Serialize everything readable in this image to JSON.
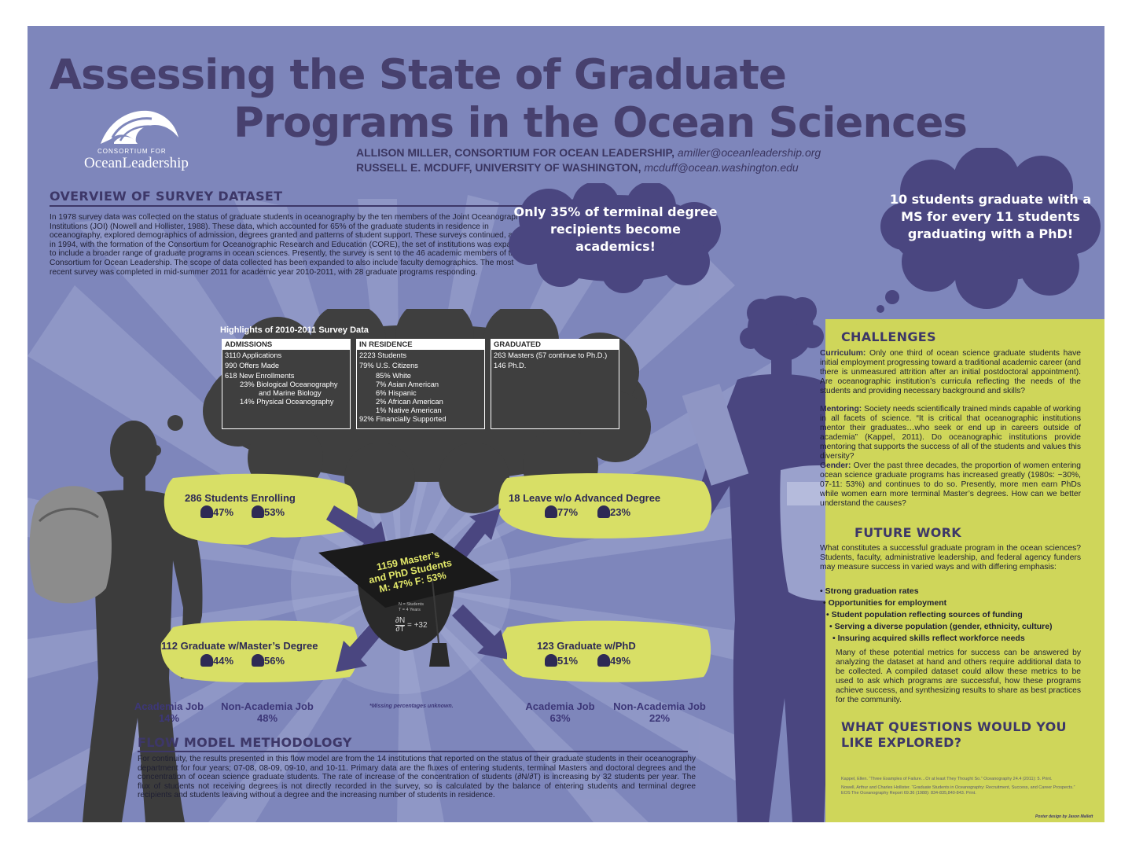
{
  "title": {
    "line1": "Assessing the State of Graduate",
    "line2": "Programs in the Ocean Sciences"
  },
  "logo": {
    "small": "CONSORTIUM FOR",
    "brand_part1": "Ocean",
    "brand_part2": "Leadership"
  },
  "authors": [
    {
      "name": "ALLISON MILLER, CONSORTIUM FOR OCEAN LEADERSHIP,",
      "email": "amiller@oceanleadership.org"
    },
    {
      "name": "RUSSELL E. MCDUFF, UNIVERSITY OF WASHINGTON,",
      "email": "mcduff@ocean.washington.edu"
    }
  ],
  "overview": {
    "heading": "OVERVIEW OF SURVEY DATASET",
    "body": "In 1978 survey data was collected on the status of graduate students in oceanography by the ten members of the Joint Oceanographic Institutions (JOI) (Nowell and Hollister, 1988). These data, which accounted for 65% of the graduate students in residence in oceanography, explored demographics of admission, degrees granted and patterns of student support. These surveys continued, and in 1994, with the formation of the Consortium for Oceanographic Research and Education (CORE), the set of institutions was expanded to include a broader range of graduate programs in ocean sciences. Presently, the survey is sent to the 46 academic members of the Consortium for Ocean Leadership. The scope of data collected has been expanded to also include faculty demographics. The most recent survey was completed in mid-summer 2011 for academic year 2010-2011, with 28 graduate programs responding."
  },
  "clouds": {
    "academics": "Only 35% of terminal degree recipients become academics!",
    "ms_phd": "10 students graduate with a MS for every 11 students graduating with a PhD!"
  },
  "highlights": {
    "title": "Highlights of 2010-2011 Survey Data",
    "admissions": {
      "heading": "ADMISSIONS",
      "lines": [
        "3110 Applications",
        "990 Offers Made",
        "618 New Enrollments",
        "23%  Biological Oceanography",
        "and Marine Biology",
        "14%  Physical Oceanography"
      ]
    },
    "residence": {
      "heading": "IN RESIDENCE",
      "lines": [
        "2223 Students",
        "79% U.S. Citizens",
        "85% White",
        "7% Asian American",
        "6% Hispanic",
        "2% African American",
        "1% Native American",
        "92% Financially Supported"
      ]
    },
    "graduated": {
      "heading": "GRADUATED",
      "lines": [
        "263 Masters (57 continue to Ph.D.)",
        "146 Ph.D."
      ]
    }
  },
  "flow": {
    "enrolling": {
      "label": "286 Students Enrolling",
      "male": "47%",
      "female": "53%"
    },
    "leave": {
      "label": "18 Leave w/o Advanced Degree",
      "male": "77%",
      "female": "23%"
    },
    "masters": {
      "label": "112 Graduate w/Master’s Degree",
      "male": "44%",
      "female": "56%"
    },
    "phd": {
      "label": "123 Graduate w/PhD",
      "male": "51%",
      "female": "49%"
    },
    "cap": {
      "line1": "1159 Master’s",
      "line2": "and PhD Students",
      "line3": "M: 47%   F: 53%",
      "legend1": "N = Students",
      "legend2": "T = 4 Years",
      "rate_num": "∂N",
      "rate_den": "∂T",
      "rate_val": "= +32"
    },
    "masters_jobs": {
      "academia_label": "Academia Job",
      "academia_pct": "14%",
      "nonacademia_label": "Non-Academia Job",
      "nonacademia_pct": "48%"
    },
    "phd_jobs": {
      "academia_label": "Academia Job",
      "academia_pct": "63%",
      "nonacademia_label": "Non-Academia Job",
      "nonacademia_pct": "22%"
    },
    "missing_note": "*Missing percentages unknown."
  },
  "methodology": {
    "heading": "FLOW MODEL METHODOLOGY",
    "body": "For continuity, the results presented in this flow model are from the 14 institutions that reported on the status of their graduate students in their oceanography department for four years; 07-08, 08-09, 09-10, and 10-11. Primary data are the fluxes of entering students, terminal Masters and doctoral degrees and the concentration of ocean science graduate students. The rate of increase of the concentration of students (∂N/∂T) is increasing by 32 students per year. The flux of students not receiving degrees is not directly recorded in the survey, so is calculated by the balance of entering students and terminal degree recipients and students leaving without a degree and the increasing number of students in residence."
  },
  "challenges": {
    "heading": "CHALLENGES",
    "curriculum_label": "Curriculum:",
    "curriculum": "Only one third of ocean science graduate students have initial employment progressing toward a traditional academic career (and there is unmeasured attrition after an initial postdoctoral appointment). Are oceanographic institution’s curricula reflecting the needs of the students and providing necessary background and skills?",
    "mentoring_label": "Mentoring:",
    "mentoring": "Society needs scientifically trained minds capable of working in all facets of science. “It is critical that oceanographic institutions mentor their graduates…who seek or end up in careers outside of academia” (Kappel, 2011). Do oceanographic institutions provide mentoring that supports the success of all of the students and values this diversity?",
    "gender_label": "Gender:",
    "gender": "Over the past three decades, the proportion of women entering ocean science graduate programs has increased greatly (1980s: ~30%, 07-11: 53%) and continues to do so. Presently, more men earn PhDs while women earn more terminal Master’s degrees. How can we better understand the causes?"
  },
  "future": {
    "heading": "FUTURE WORK",
    "intro": "What constitutes a successful graduate program in the ocean sciences? Students, faculty, administrative leadership, and federal agency funders may measure success in varied ways and with differing emphasis:",
    "bullets": [
      "Strong graduation rates",
      "Opportunities for employment",
      "Student population reflecting sources of funding",
      "Serving a diverse population (gender, ethnicity, culture)",
      "Insuring acquired skills reflect workforce needs"
    ],
    "closing": "Many of these potential metrics for success can be answered by analyzing the dataset at hand and others require additional data to be collected. A compiled dataset could allow these metrics to be used to ask which programs are successful, how these programs achieve success, and synthesizing results to share as best practices for the community."
  },
  "questions": {
    "heading_line1": "WHAT QUESTIONS WOULD YOU",
    "heading_line2": "LIKE EXPLORED?"
  },
  "references": [
    "Kappel, Ellen. “Three Examples of Failure…Or at least They Thought So.” Oceanography 24.4 (2011): 5. Print.",
    "Nowell, Arthur and Charles Hollister. “Graduate Students in Oceanography: Recruitment, Success, and Career Prospects.” EOS The Oceanography Report 69.36 (1988): 834-835,840-843. Print."
  ],
  "credit": "Poster design by Jason Mallett",
  "colors": {
    "background": "#7e86bb",
    "title": "#47406e",
    "panel": "#cfd65a",
    "bubble": "#d8df66",
    "dark": "#3f3f3f",
    "figure": "#4a4680"
  }
}
